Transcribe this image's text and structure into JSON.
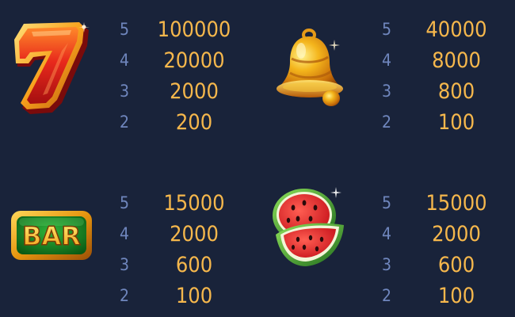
{
  "colors": {
    "background": "#19233a",
    "count_text": "#6f86bd",
    "payout_text": "#f5b74c"
  },
  "symbols": [
    {
      "icon": "seven-icon",
      "rows": [
        {
          "count": "5",
          "payout": "100000"
        },
        {
          "count": "4",
          "payout": "20000"
        },
        {
          "count": "3",
          "payout": "2000"
        },
        {
          "count": "2",
          "payout": "200"
        }
      ]
    },
    {
      "icon": "bell-icon",
      "rows": [
        {
          "count": "5",
          "payout": "40000"
        },
        {
          "count": "4",
          "payout": "8000"
        },
        {
          "count": "3",
          "payout": "800"
        },
        {
          "count": "2",
          "payout": "100"
        }
      ]
    },
    {
      "icon": "bar-icon",
      "label": "BAR",
      "rows": [
        {
          "count": "5",
          "payout": "15000"
        },
        {
          "count": "4",
          "payout": "2000"
        },
        {
          "count": "3",
          "payout": "600"
        },
        {
          "count": "2",
          "payout": "100"
        }
      ]
    },
    {
      "icon": "watermelon-icon",
      "rows": [
        {
          "count": "5",
          "payout": "15000"
        },
        {
          "count": "4",
          "payout": "2000"
        },
        {
          "count": "3",
          "payout": "600"
        },
        {
          "count": "2",
          "payout": "100"
        }
      ]
    }
  ]
}
